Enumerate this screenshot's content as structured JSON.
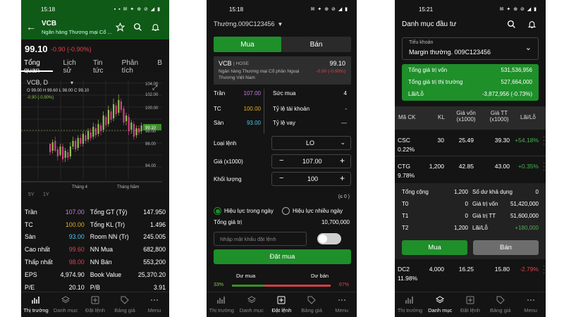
{
  "p1": {
    "status_time": "15:18",
    "status_icons": "▪ ▪ ✉ ✦ ⊕ ⊘ ◢ ▮",
    "symbol": "VCB",
    "bank_name": "Ngân hàng Thương mại Cổ ...",
    "price": "99.10",
    "change": "-0.90 (-0.90%)",
    "tabs": [
      "Tổng quan",
      "Lịch sử",
      "Tin tức",
      "Phân tích",
      "B"
    ],
    "chart_title": "VCB, D",
    "ohlc": "O 99.00  H 99.60  L 98.00  C 99.10",
    "chart_change": "-0.90 (-0.90%)",
    "y_ticks": [
      "104.00",
      "102.00",
      "100.00",
      "99.10",
      "98.00",
      "96.00",
      "94.00"
    ],
    "x_ticks": [
      "Tháng 4",
      "Tháng Năm"
    ],
    "periods": [
      "5Y",
      "1Y"
    ],
    "stats": [
      [
        "Trần",
        "107.00",
        "Tổng GT (Tỷ)",
        "147.950"
      ],
      [
        "TC",
        "100.00",
        "Tổng KL (Tr)",
        "1.496"
      ],
      [
        "Sàn",
        "93.00",
        "Room NN (Tr)",
        "245.005"
      ],
      [
        "Cao nhất",
        "99.60",
        "NN Mua",
        "682,800"
      ],
      [
        "Thấp nhất",
        "98.00",
        "NN Bán",
        "553,200"
      ],
      [
        "EPS",
        "4,974.90",
        "Book Value",
        "25,370.20"
      ],
      [
        "P/E",
        "20.10",
        "P/B",
        "3.91"
      ]
    ],
    "nav": [
      "Thị trường",
      "Danh mục",
      "Đặt lệnh",
      "Bảng giá",
      "Menu"
    ]
  },
  "p2": {
    "status_time": "15:18",
    "status_icons": "✉ ✦ ⊕ ⊘ ◢ ▮",
    "account": "Thường.009C123456",
    "buy": "Mua",
    "sell": "Bán",
    "symbol": "VCB",
    "exchange": "| HOSE",
    "price": "99.10",
    "company": "Ngân hàng Thương mại Cổ phần Ngoại Thương Việt Nam",
    "change": "-0.90 (-0.90%)",
    "tran_l": "Trần",
    "tran": "107.00",
    "tc_l": "TC",
    "tc": "100.00",
    "san_l": "Sàn",
    "san": "93.00",
    "sucmua_l": "Sức mua",
    "sucmua": "4",
    "tl_tk_l": "Tỷ lệ tài khoản",
    "tl_tk": "-",
    "tl_vay_l": "Tỷ lệ vay",
    "tl_vay": "---",
    "loai_l": "Loại lệnh",
    "loai": "LO",
    "gia_l": "Giá (x1000)",
    "gia": "107.00",
    "kl_l": "Khối lượng",
    "kl": "100",
    "minus": "−",
    "plus": "+",
    "so": "(≤ 0 )",
    "hl1": "Hiệu lực trong ngày",
    "hl2": "Hiệu lực nhiều ngày",
    "tgt_l": "Tổng giá trị",
    "tgt": "10,700,000",
    "pw_ph": "Nhập mật khẩu đặt lệnh",
    "order": "Đặt mua",
    "du_mua": "Dư mua",
    "du_ban": "Dư bán",
    "pct_mua": "33%",
    "pct_ban": "67%",
    "nav": [
      "Thị trường",
      "Danh mục",
      "Đặt lệnh",
      "Bảng giá",
      "Menu"
    ]
  },
  "p3": {
    "status_time": "15:21",
    "status_icons": "✉ ✦ ⊕ ⊘ ◢ ▮",
    "title": "Danh mục đầu tư",
    "sub_l": "Tiểu khoản",
    "sub": "Margin thường. 009C123456",
    "sum": [
      [
        "Tổng giá trị vốn",
        "531,536,956"
      ],
      [
        "Tổng giá trị thị trường",
        "527,664,000"
      ],
      [
        "Lãi/Lỗ",
        "-3,872,956 (-0.73%)"
      ]
    ],
    "cols": [
      "Mã CK",
      "KL",
      "Giá vốn (x1000)",
      "Giá TT (x1000)",
      "Lãi/Lỗ"
    ],
    "rows": [
      {
        "ck": "CSC",
        "pct": "0.22%",
        "kl": "30",
        "gv": "25.49",
        "gt": "39.30",
        "ll": "+54.18%"
      },
      {
        "ck": "CTG",
        "pct": "9.78%",
        "kl": "1,200",
        "gv": "42.85",
        "gt": "43.00",
        "ll": "+0.35%"
      }
    ],
    "det": [
      [
        "Tổng cộng",
        "1,200",
        "Số dư khả dụng",
        "0"
      ],
      [
        "T0",
        "0",
        "Giá trị vốn",
        "51,420,000"
      ],
      [
        "T1",
        "0",
        "Giá trị TT",
        "51,600,000"
      ],
      [
        "T2",
        "1,200",
        "Lãi/Lỗ",
        "+180,000"
      ]
    ],
    "buy": "Mua",
    "sell": "Bán",
    "row3": {
      "ck": "DC2",
      "pct": "11.98%",
      "kl": "4,000",
      "gv": "16.25",
      "gt": "15.80",
      "ll": "-2.79%"
    },
    "nav": [
      "Thị trường",
      "Danh mục",
      "Đặt lệnh",
      "Bảng giá",
      "Menu"
    ]
  },
  "colors": {
    "green": "#1f8f2a",
    "dark_green": "#0f5a17",
    "red": "#e0424b",
    "yellow": "#e0b020",
    "purple": "#c77ee0",
    "cyan": "#4fc3e6",
    "bull": "#8bc34a",
    "bear": "#d63d8a"
  }
}
